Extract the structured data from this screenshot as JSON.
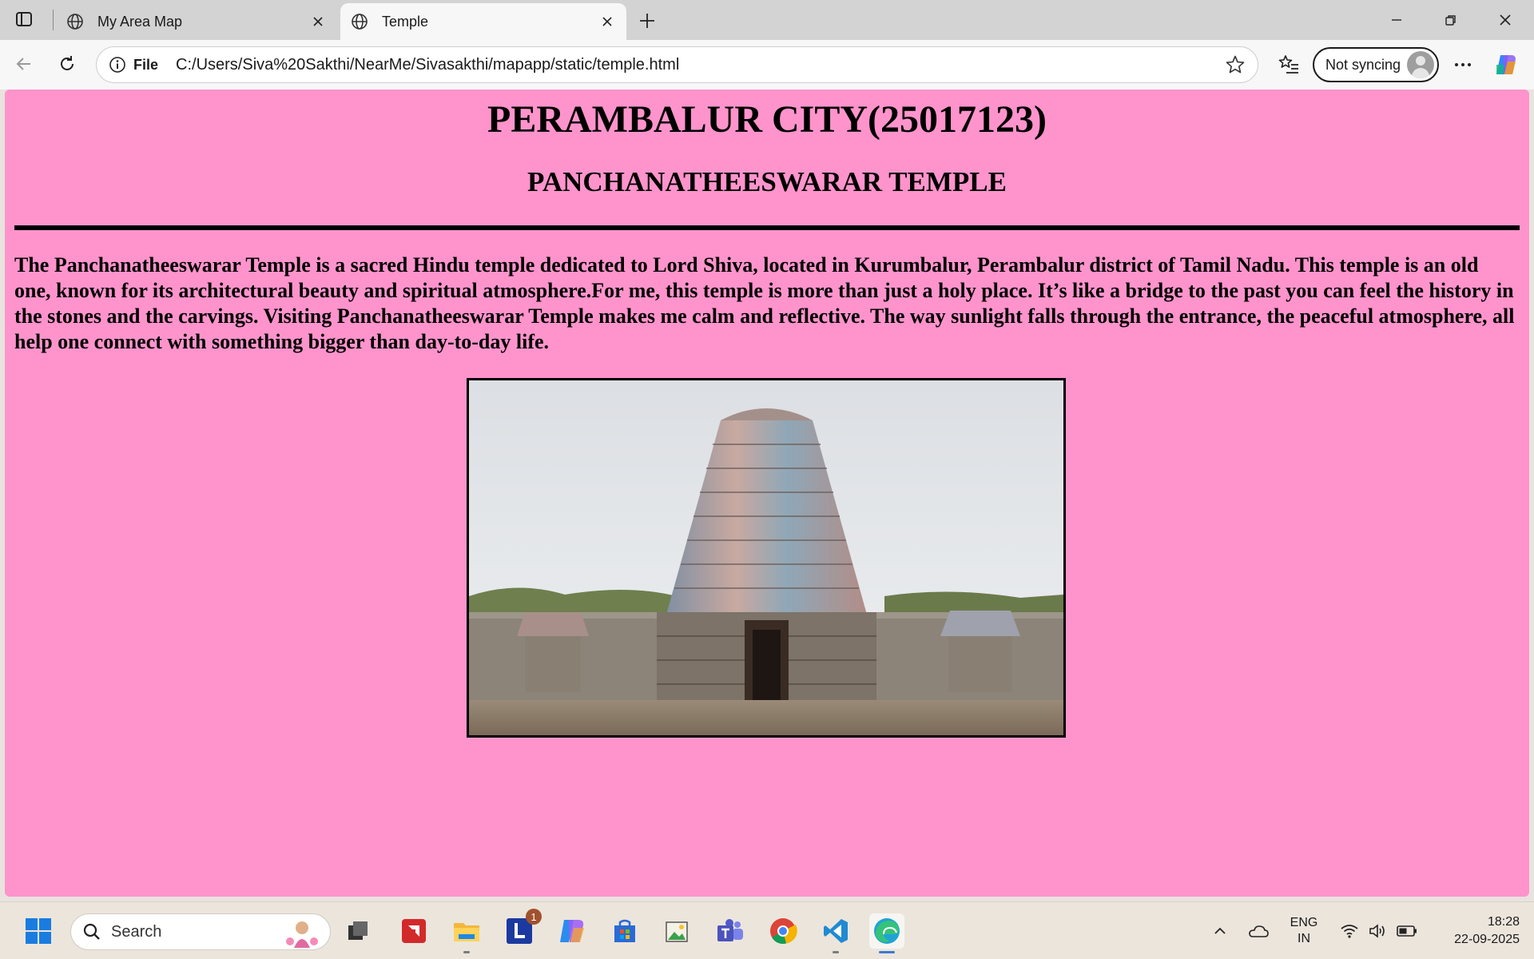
{
  "browser": {
    "tabs": [
      {
        "label": "My Area Map",
        "active": false
      },
      {
        "label": "Temple",
        "active": true
      }
    ],
    "address": {
      "scheme_label": "File",
      "url": "C:/Users/Siva%20Sakthi/NearMe/Sivasakthi/mapapp/static/temple.html"
    },
    "profile": {
      "sync_label": "Not syncing"
    }
  },
  "page": {
    "background": "#ff94cc",
    "heading": "PERAMBALUR CITY(25017123)",
    "subheading": "PANCHANATHEESWARAR TEMPLE",
    "paragraph": "The Panchanatheeswarar Temple is a sacred Hindu temple dedicated to Lord Shiva, located in Kurumbalur, Perambalur district of Tamil Nadu. This temple is an old one, known for its architectural beauty and spiritual atmosphere.For me, this temple is more than just a holy place. It’s like a bridge to the past you can feel the history in the stones and the carvings. Visiting Panchanatheeswarar Temple makes me calm and reflective. The way sunlight falls through the entrance, the peaceful atmosphere, all help one connect with something bigger than day-to-day life."
  },
  "taskbar": {
    "search_placeholder": "Search",
    "apps": [
      "start-icon",
      "task-view-icon",
      "amd-software-icon",
      "file-explorer-icon",
      "l-app-icon",
      "copilot-icon",
      "microsoft-store-icon",
      "photo-editor-icon",
      "teams-icon",
      "chrome-icon",
      "vscode-icon",
      "edge-icon"
    ],
    "badge_count": "1",
    "language": {
      "line1": "ENG",
      "line2": "IN"
    },
    "clock": {
      "time": "18:28",
      "date": "22-09-2025"
    }
  }
}
